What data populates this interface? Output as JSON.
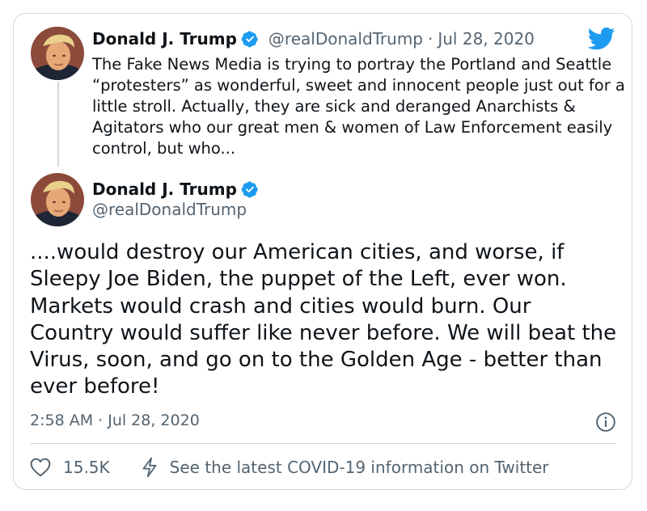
{
  "colors": {
    "brand_blue": "#1d9bf0",
    "text": "#0f1419",
    "secondary": "#536471",
    "border": "#cfd9de"
  },
  "icons": {
    "verified": "verified-badge-icon",
    "twitter": "twitter-bird-icon",
    "info": "info-icon",
    "like": "heart-icon",
    "covid": "lightning-bolt-icon"
  },
  "tweet1": {
    "display_name": "Donald J. Trump",
    "handle": "@realDonaldTrump",
    "separator": "·",
    "date": "Jul 28, 2020",
    "text": "The Fake News Media is trying to portray the Portland and Seattle “protesters” as wonderful, sweet and innocent people just out for a little stroll. Actually, they are sick and deranged Anarchists & Agitators who our great men & women of Law Enforcement easily control, but who..."
  },
  "tweet2": {
    "display_name": "Donald J. Trump",
    "handle": "@realDonaldTrump",
    "text": "....would destroy our American cities, and worse, if Sleepy Joe Biden, the puppet of the Left, ever won. Markets would crash and cities would burn. Our Country would suffer like never before. We will beat the Virus, soon, and go on to the Golden Age - better than ever before!",
    "timestamp": "2:58 AM · Jul 28, 2020"
  },
  "actions": {
    "like_count": "15.5K",
    "covid_link": "See the latest COVID-19 information on Twitter"
  }
}
